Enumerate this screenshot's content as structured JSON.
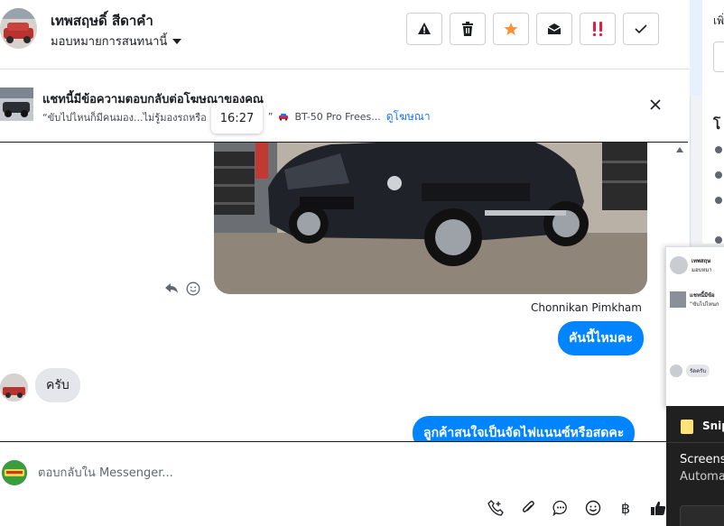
{
  "header": {
    "contact_name": "เทพสฤษดิ์ สีดาคำ",
    "assign_label": "มอบหมายการสนทนานี้",
    "toolbar": [
      {
        "name": "report-spam-button",
        "icon": "warning-icon"
      },
      {
        "name": "delete-button",
        "icon": "trash-icon"
      },
      {
        "name": "star-button",
        "icon": "star-icon"
      },
      {
        "name": "mark-unread-button",
        "icon": "envelope-icon"
      },
      {
        "name": "follow-up-button",
        "icon": "exclamation-icon"
      },
      {
        "name": "mark-done-button",
        "icon": "check-icon"
      }
    ]
  },
  "ad_banner": {
    "title": "แชทนี้มีข้อความตอบกลับต่อโฆษณาของคุณ",
    "quote": "“ขับไปไหนก็มีคนมอง...ไม่รู้มองรถหรือ",
    "quote_end": "”",
    "product": "BT-50 Pro Frees...",
    "link": "ดูโฆษณา",
    "tooltip_time": "16:27"
  },
  "thread": {
    "sender_name": "Chonnikan Pimkham",
    "messages": [
      {
        "direction": "out",
        "text": "คันนี้ไหมคะ"
      },
      {
        "direction": "in",
        "text": "ครับ"
      },
      {
        "direction": "out",
        "text": "ลูกค้าสนใจเป็นจัดไฟแนนซ์หรือสดคะ"
      }
    ]
  },
  "composer": {
    "placeholder": "ตอบกลับใน Messenger...",
    "tools": [
      "call-icon",
      "attachment-icon",
      "saved-reply-icon",
      "emoji-icon",
      "payment-icon",
      "like-icon"
    ],
    "baht_symbol": "฿"
  },
  "side_panel": {
    "top_text": "เพิ่",
    "section_label": "โ"
  },
  "preview_window": {
    "row1": "เทพสฤษ",
    "row1_sub": "มอบหมา",
    "row2": "แชทนี้มีข้อ",
    "row2_sub": "“ขับไปไหนก",
    "pill": "รัดครับ"
  },
  "snip_overlay": {
    "title": "Snipp",
    "line1": "Screensh",
    "line2": "Automa"
  },
  "colors": {
    "accent": "#0084ff",
    "link": "#1877f2",
    "star": "#f7923b",
    "alert_red": "#e41e3f"
  }
}
